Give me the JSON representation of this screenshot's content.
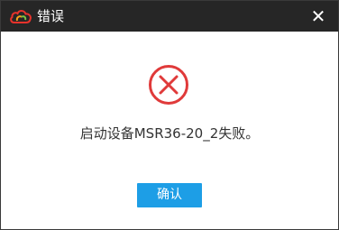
{
  "window": {
    "title": "错误",
    "logo_icon": "cloud-logo-icon",
    "close_label": "✕"
  },
  "content": {
    "status_icon": "error-circle-x-icon",
    "status_color": "#e03a3a",
    "message": "启动设备MSR36-20_2失败。"
  },
  "actions": {
    "confirm_label": "确认",
    "confirm_color": "#1d9ee6"
  }
}
